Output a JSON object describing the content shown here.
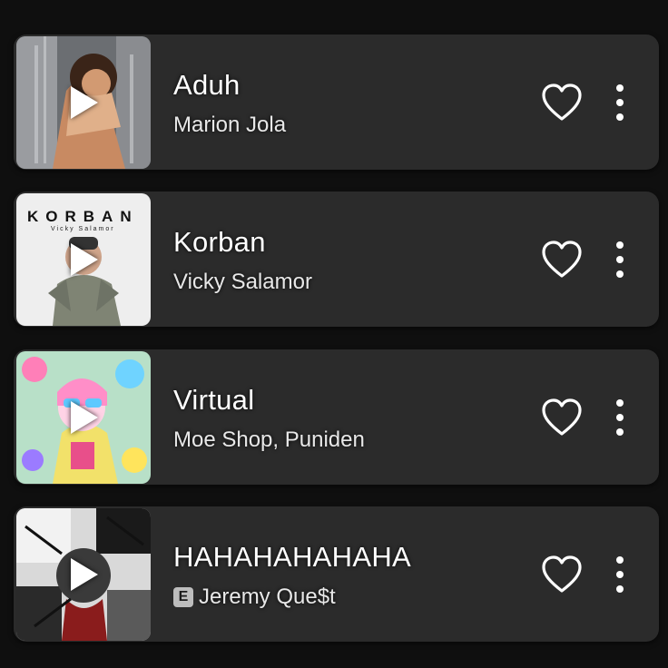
{
  "tracks": [
    {
      "title": "Aduh",
      "artist": "Marion Jola",
      "explicit": false,
      "cover_icon": "album-cover-photo"
    },
    {
      "title": "Korban",
      "artist": "Vicky Salamor",
      "explicit": false,
      "cover_text": "KORBAN",
      "cover_subtext": "Vicky Salamor",
      "cover_icon": "album-cover-photo"
    },
    {
      "title": "Virtual",
      "artist": "Moe Shop, Puniden",
      "explicit": false,
      "cover_icon": "album-cover-illustration"
    },
    {
      "title": "HAHAHAHAHAHA",
      "artist": "Jeremy Que$t",
      "explicit": true,
      "explicit_label": "E",
      "cover_icon": "album-cover-collage"
    }
  ],
  "icons": {
    "play": "play-icon",
    "like": "heart-outline-icon",
    "more": "more-vertical-icon"
  },
  "colors": {
    "background": "#0f0f0f",
    "card": "#2b2b2b",
    "text": "#ffffff",
    "subtext": "#e8e8e8"
  }
}
